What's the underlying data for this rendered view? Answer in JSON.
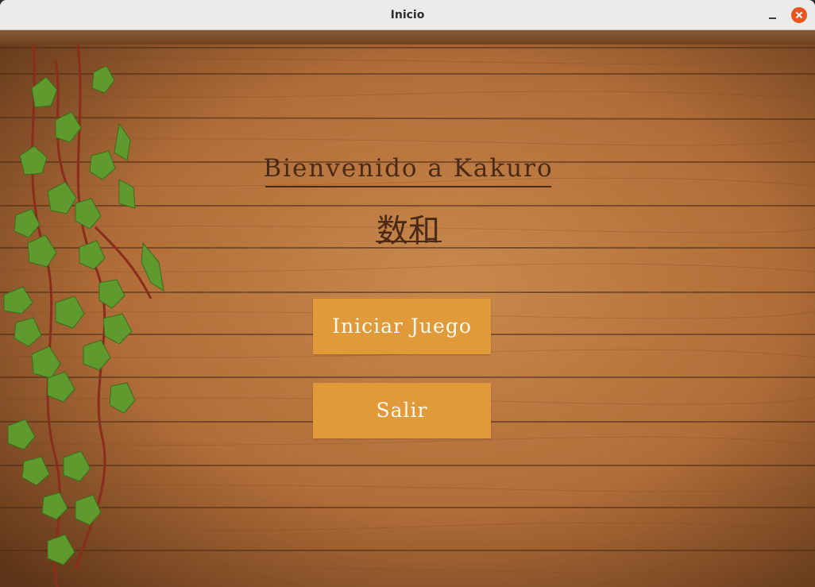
{
  "window": {
    "title": "Inicio",
    "controls": {
      "minimize": "minimize-icon",
      "close": "close-icon"
    }
  },
  "main": {
    "heading": "Bienvenido a Kakuro",
    "kanji": "数和",
    "buttons": {
      "start": "Iniciar Juego",
      "exit": "Salir"
    }
  },
  "colors": {
    "button": "#e09a3a",
    "button_text": "#fffaf0",
    "heading": "#4a2a16",
    "wood": "#b2733f",
    "close": "#e95420"
  }
}
